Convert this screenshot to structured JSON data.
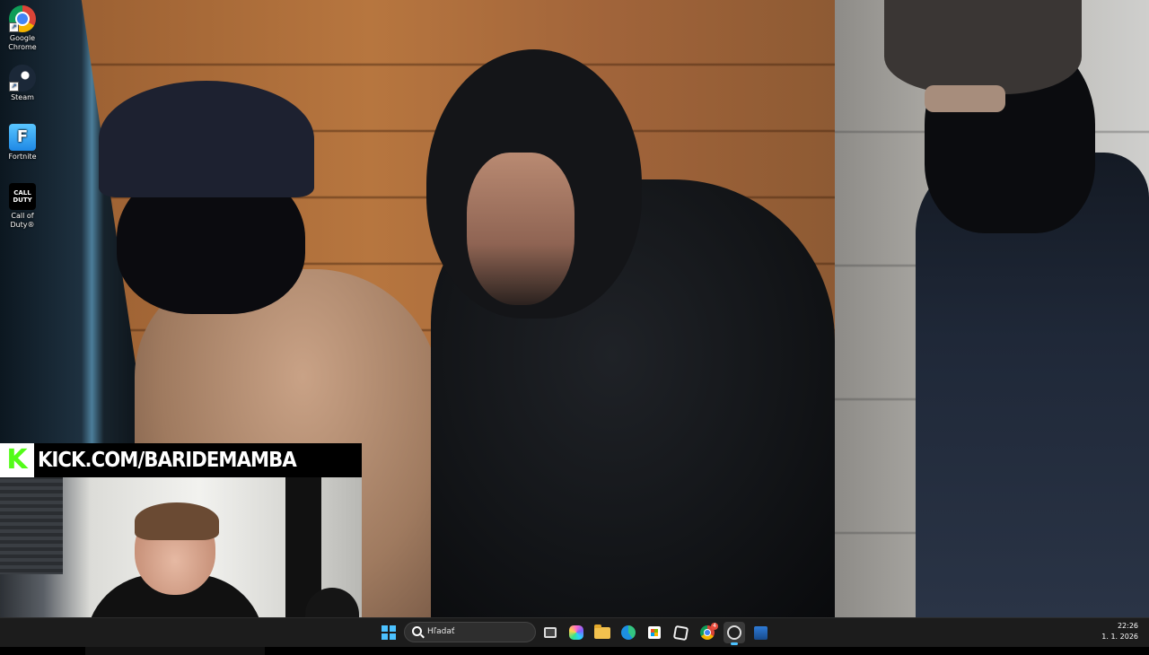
{
  "desktop": {
    "icons": [
      {
        "label": "Google Chrome",
        "icon": "chrome-icon"
      },
      {
        "label": "Steam",
        "icon": "steam-icon"
      },
      {
        "label": "Fortnite",
        "icon": "fortnite-icon",
        "glyph": "F"
      },
      {
        "label": "Call of Duty®",
        "icon": "call-of-duty-icon",
        "glyph": "CALL DUTY"
      }
    ]
  },
  "stream_overlay": {
    "kick_logo_glyph": "K",
    "channel_url": "KICK.COM/BARIDEMAMBA",
    "brand_color": "#53fc18"
  },
  "taskbar": {
    "search_placeholder": "Hľadať",
    "chrome_badge": "4",
    "clock": {
      "time": "22:26",
      "date": "1. 1. 2026"
    },
    "accent_color": "#4cc2ff",
    "pinned": [
      "start-icon",
      "search-icon",
      "task-view-icon",
      "copilot-icon",
      "file-explorer-icon",
      "edge-icon",
      "store-icon",
      "outline-app-icon",
      "chrome-icon",
      "obs-icon",
      "app-icon"
    ]
  }
}
